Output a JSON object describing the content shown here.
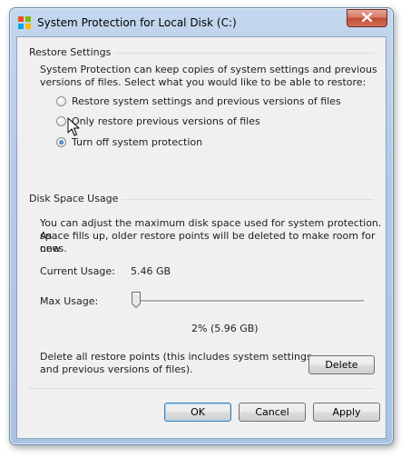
{
  "window": {
    "title": "System Protection for Local Disk (C:)"
  },
  "restore_settings": {
    "group_label": "Restore Settings",
    "description_line1": "System Protection can keep copies of system settings and previous",
    "description_line2": "versions of files. Select what you would like to be able to restore:",
    "options": [
      {
        "label": "Restore system settings and previous versions of files",
        "selected": false
      },
      {
        "label": "Only restore previous versions of files",
        "selected": false
      },
      {
        "label": "Turn off system protection",
        "selected": true
      }
    ]
  },
  "disk_space": {
    "group_label": "Disk Space Usage",
    "description_line1": "You can adjust the maximum disk space used for system protection. As",
    "description_line2": "space fills up, older restore points will be deleted to make room for new",
    "description_line3": "ones.",
    "current_usage_label": "Current Usage:",
    "current_usage_value": "5.46 GB",
    "max_usage_label": "Max Usage:",
    "max_usage_fraction": 0.02,
    "max_usage_value": "2% (5.96 GB)",
    "delete_text_line1": "Delete all restore points (this includes system settings",
    "delete_text_line2": "and previous versions of files).",
    "delete_button": "Delete"
  },
  "footer": {
    "ok": "OK",
    "cancel": "Cancel",
    "apply": "Apply"
  },
  "icons": {
    "app": "system-protection-shield-icon",
    "close": "close-x-icon",
    "cursor": "mouse-pointer-icon"
  }
}
